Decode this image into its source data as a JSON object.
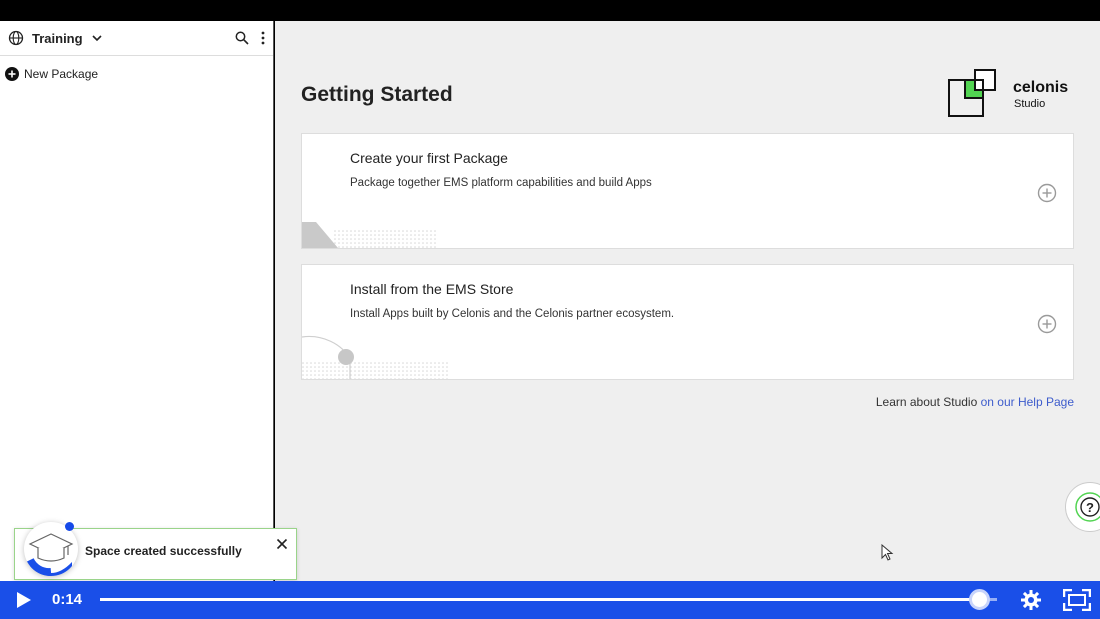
{
  "sidebar": {
    "space_name": "Training",
    "new_package_label": "New Package"
  },
  "main": {
    "title": "Getting Started",
    "logo": {
      "brand": "celonis",
      "product": "Studio"
    },
    "cards": [
      {
        "title": "Create your first Package",
        "description": "Package together EMS platform capabilities and build Apps"
      },
      {
        "title": "Install from the EMS Store",
        "description": "Install Apps built by Celonis and the Celonis partner ecosystem."
      }
    ],
    "help": {
      "text": "Learn about Studio ",
      "link": "on our Help Page"
    }
  },
  "toast": {
    "message": "Space created successfully"
  },
  "player": {
    "time": "0:14",
    "progress": 0.98
  },
  "colors": {
    "accent": "#1a4fe8",
    "link": "#3d5ccc",
    "logo_green": "#52d452"
  }
}
